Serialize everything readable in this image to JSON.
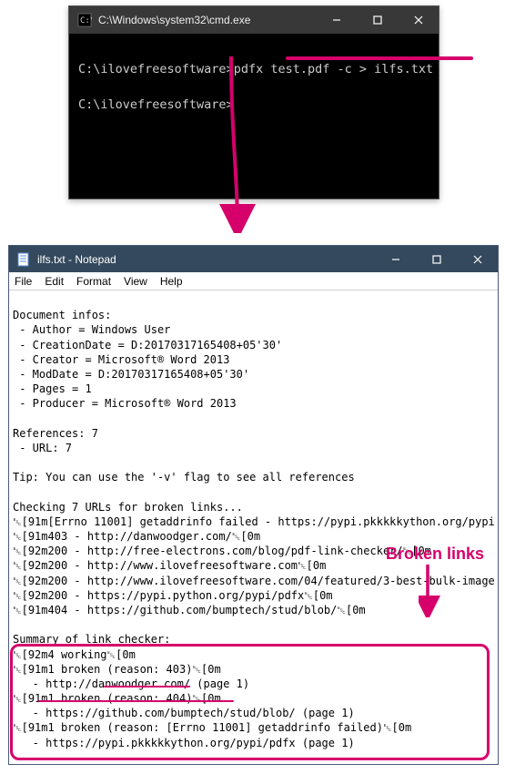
{
  "cmd": {
    "title": "C:\\Windows\\system32\\cmd.exe",
    "prompt": "C:\\ilovefreesoftware>",
    "commandText": "pdfx test.pdf -c > ilfs.txt",
    "line2": "C:\\ilovefreesoftware>"
  },
  "notepad": {
    "title": "ilfs.txt - Notepad",
    "menu": {
      "file": "File",
      "edit": "Edit",
      "format": "Format",
      "view": "View",
      "help": "Help"
    },
    "docinfos": {
      "header": "Document infos:",
      "author": " - Author = Windows User",
      "creation": " - CreationDate = D:20170317165408+05'30'",
      "creator": " - Creator = Microsoft® Word 2013",
      "moddate": " - ModDate = D:20170317165408+05'30'",
      "pages": " - Pages = 1",
      "producer": " - Producer = Microsoft® Word 2013"
    },
    "refs": {
      "header": "References: 7",
      "url": " - URL: 7"
    },
    "tip": "Tip: You can use the '-v' flag to see all references",
    "checking": "Checking 7 URLs for broken links...",
    "log": {
      "l1": "␛[91m[Errno 11001] getaddrinfo failed - https://pypi.pkkkkkython.org/pypi",
      "l2": "␛[91m403 - http://danwoodger.com/␛[0m",
      "l3": "␛[92m200 - http://free-electrons.com/blog/pdf-link-checker/␛[0m",
      "l4": "␛[92m200 - http://www.ilovefreesoftware.com␛[0m",
      "l5": "␛[92m200 - http://www.ilovefreesoftware.com/04/featured/3-best-bulk-image",
      "l6": "␛[92m200 - https://pypi.python.org/pypi/pdfx␛[0m",
      "l7": "␛[91m404 - https://github.com/bumptech/stud/blob/␛[0m"
    },
    "summary": {
      "header": "Summary of link checker:",
      "s1": "␛[92m4 working␛[0m",
      "s2": "␛[91m1 broken (reason: 403)␛[0m",
      "s2u": "   - http://danwoodger.com/ (page 1)",
      "s3": "␛[91m1 broken (reason: 404)␛[0m",
      "s3u": "   - https://github.com/bumptech/stud/blob/ (page 1)",
      "s4": "␛[91m1 broken (reason: [Errno 11001] getaddrinfo failed)␛[0m",
      "s4u": "   - https://pypi.pkkkkkython.org/pypi/pdfx (page 1)"
    }
  },
  "annotation": {
    "label": "Broken links"
  }
}
